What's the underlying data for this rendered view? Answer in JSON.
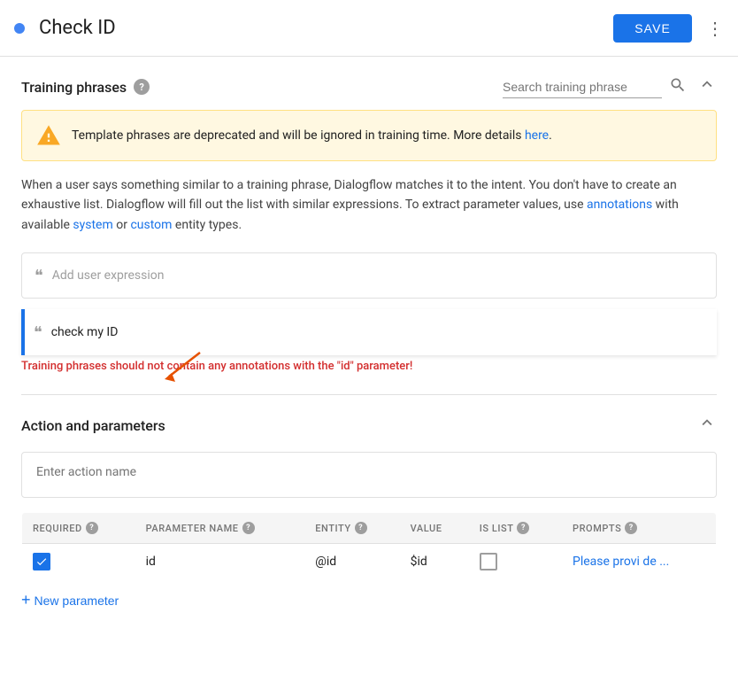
{
  "header": {
    "title": "Check ID",
    "save_label": "SAVE",
    "dot_color": "#4285f4"
  },
  "training_phrases": {
    "section_title": "Training phrases",
    "search_placeholder": "Search training phrase",
    "warning": {
      "text": "Template phrases are deprecated and will be ignored in training time. More details ",
      "link_text": "here",
      "link_suffix": "."
    },
    "info_text_parts": [
      "When a user says something similar to a training phrase, Dialogflow matches it to the intent. You don't have to create an exhaustive list. Dialogflow will fill out the list with similar expressions. To extract parameter values, use ",
      "annotations",
      " with available ",
      "system",
      " or ",
      "custom",
      " entity types."
    ],
    "add_placeholder": "Add user expression",
    "expressions": [
      {
        "text": "check my ID",
        "active": true
      }
    ],
    "error_text": "Training phrases should not contain any annotations with the \"id\" parameter!"
  },
  "action_parameters": {
    "section_title": "Action and parameters",
    "action_name_placeholder": "Enter action name",
    "table": {
      "headers": [
        {
          "label": "REQUIRED",
          "has_help": true
        },
        {
          "label": "PARAMETER NAME",
          "has_help": true
        },
        {
          "label": "ENTITY",
          "has_help": true
        },
        {
          "label": "VALUE",
          "has_help": false
        },
        {
          "label": "IS LIST",
          "has_help": true
        },
        {
          "label": "PROMPTS",
          "has_help": true
        }
      ],
      "rows": [
        {
          "required": true,
          "parameter_name": "id",
          "entity": "@id",
          "value": "$id",
          "is_list": false,
          "prompts_text": "Please provi de ..."
        }
      ]
    },
    "new_param_label": "New parameter"
  },
  "icons": {
    "more_vert": "⋮",
    "search": "🔍",
    "collapse": "▲",
    "quote": "❝",
    "warning": "⚠",
    "checkmark": "✓",
    "plus": "+"
  }
}
